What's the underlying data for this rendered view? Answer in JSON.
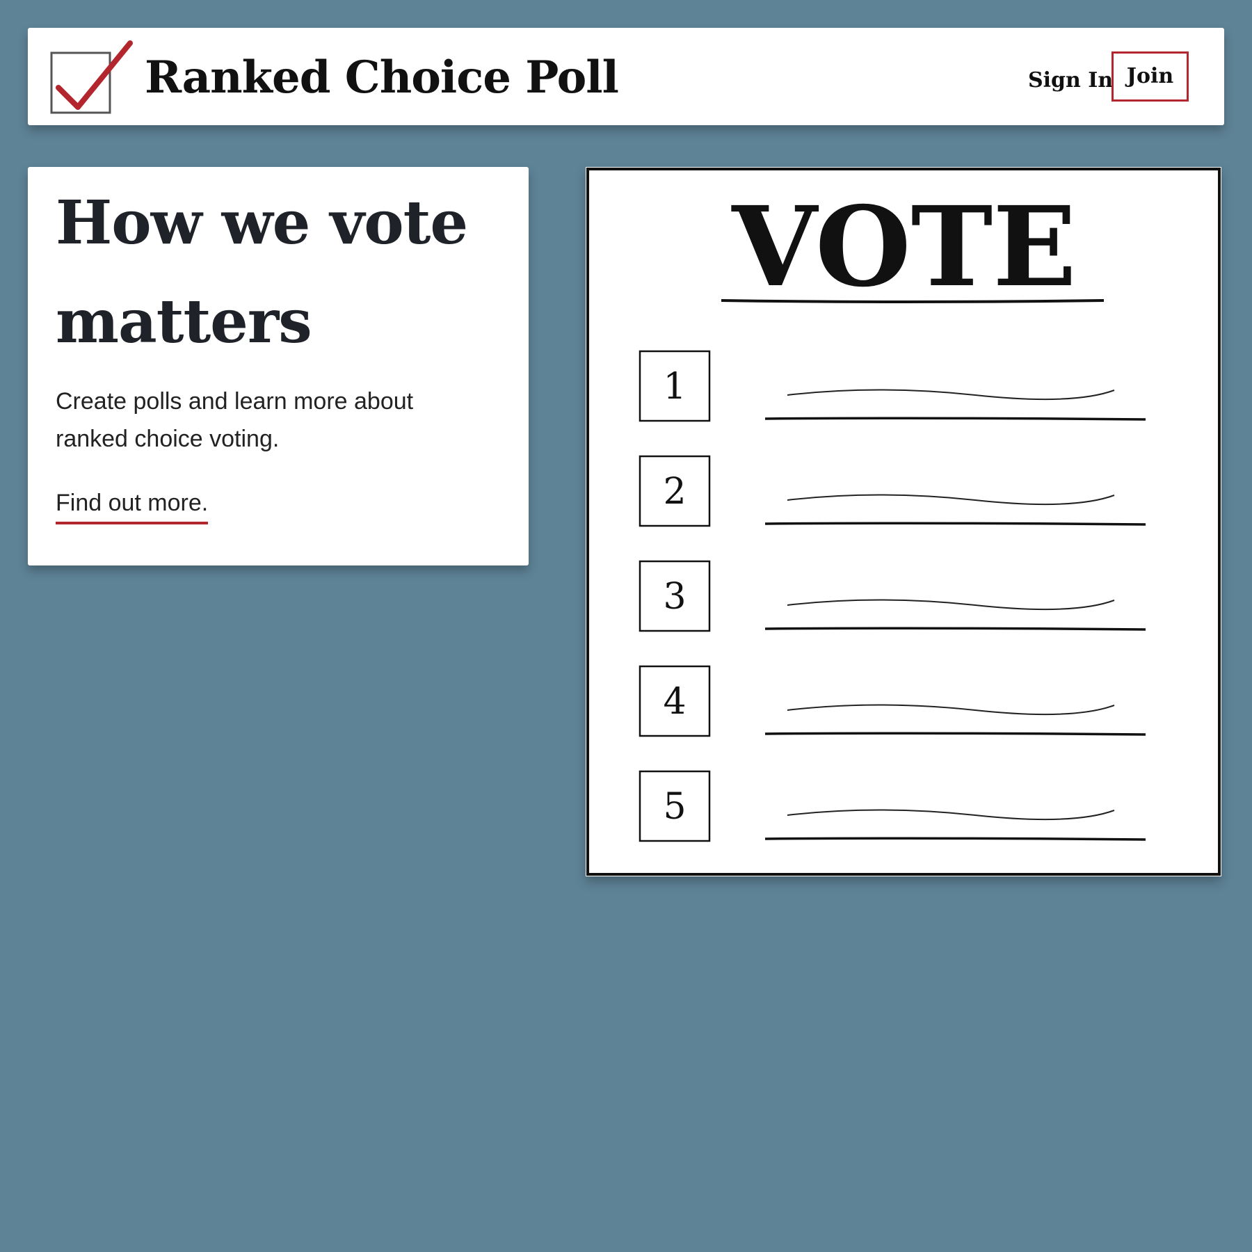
{
  "header": {
    "logo_icon": "checkbox-checkmark-icon",
    "site_title": "Ranked Choice Poll",
    "signin_label": "Sign In",
    "join_label": "Join"
  },
  "hero": {
    "title": "How we vote matters",
    "text": "Create polls and learn more about ranked choice voting.",
    "link_label": "Find out more."
  },
  "ballot": {
    "heading": "VOTE",
    "ranks": [
      "1",
      "2",
      "3",
      "4",
      "5"
    ]
  },
  "colors": {
    "background": "#5e8396",
    "accent": "#b3262d",
    "card": "#ffffff",
    "text": "#1f2329"
  }
}
